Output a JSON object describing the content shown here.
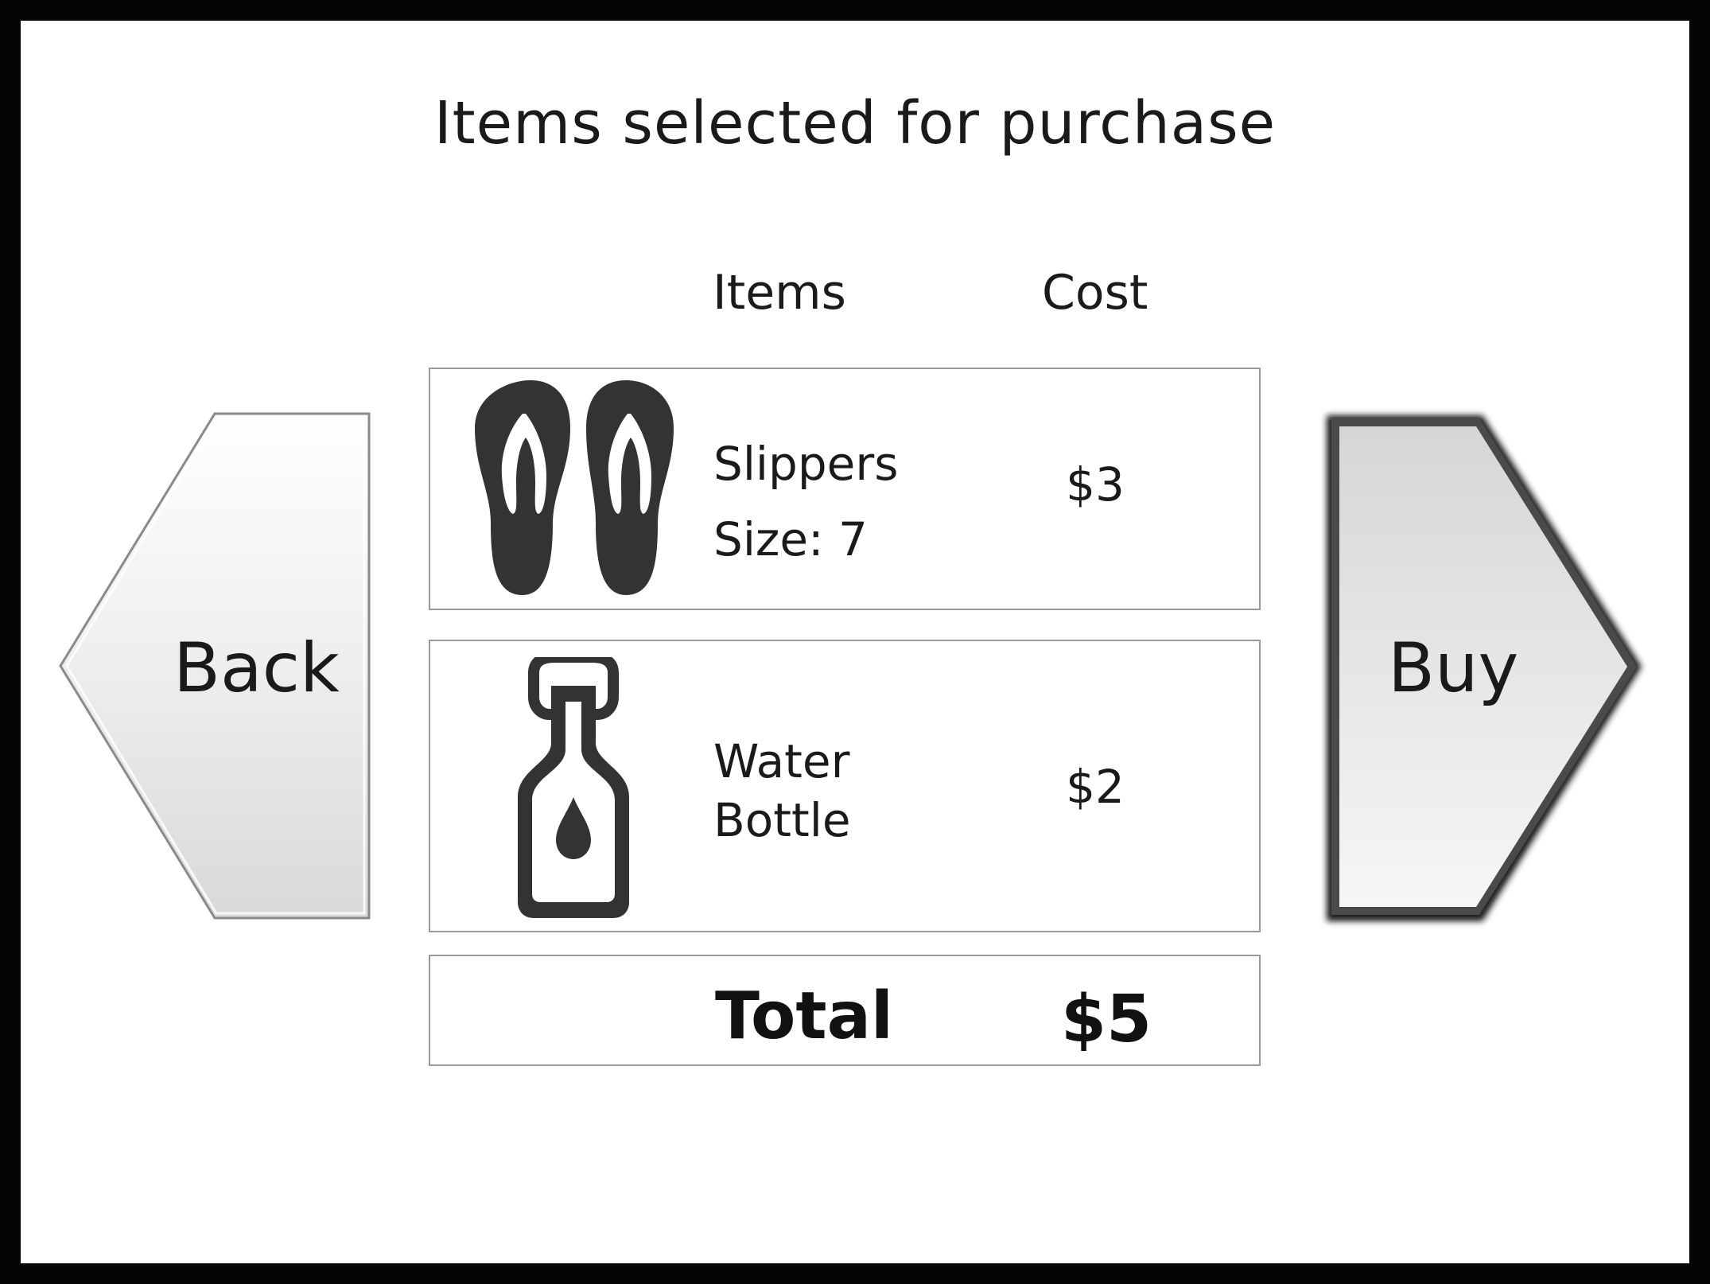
{
  "title": "Items selected for purchase",
  "columns": {
    "items": "Items",
    "cost": "Cost"
  },
  "items": [
    {
      "name": "Slippers",
      "detail": "Size: 7",
      "cost": "$3",
      "icon": "flip-flops-icon"
    },
    {
      "name_line1": "Water",
      "name_line2": "Bottle",
      "cost": "$2",
      "icon": "water-bottle-icon"
    }
  ],
  "total": {
    "label": "Total",
    "value": "$5"
  },
  "nav": {
    "back_label": "Back",
    "buy_label": "Buy"
  },
  "colors": {
    "icon": "#333333",
    "border": "#9a9a9a",
    "frame": "#050505"
  }
}
